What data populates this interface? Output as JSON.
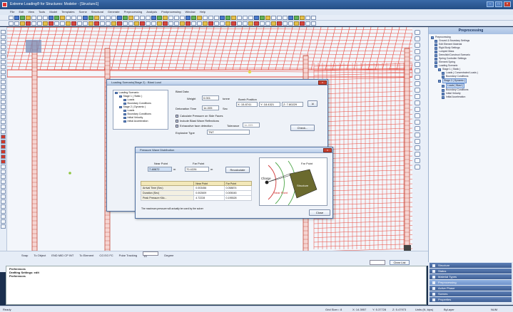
{
  "window": {
    "title": "Extreme Loading® for Structures: Modeler - [Structure1]",
    "min_label": "–",
    "max_label": "□",
    "close_label": "×"
  },
  "menu": [
    "File",
    "Edit",
    "View",
    "Tools",
    "Model",
    "Templates",
    "Scene",
    "Structural",
    "Generate",
    "Preprocessing",
    "Analysis",
    "Postprocessing",
    "Window",
    "Help"
  ],
  "right_panel": {
    "header": "Preprocessing",
    "tree": [
      {
        "label": "Preprocessing",
        "indent": 0
      },
      {
        "label": "Ground & Boundary Settings",
        "indent": 1
      },
      {
        "label": "Edit Element Material",
        "indent": 1
      },
      {
        "label": "Rigid Body Settings",
        "indent": 1
      },
      {
        "label": "Lumped Mass",
        "indent": 1
      },
      {
        "label": "Demolish/Construct Scenario",
        "indent": 1
      },
      {
        "label": "Spring Controller Settings",
        "indent": 1
      },
      {
        "label": "Element Spring",
        "indent": 1
      },
      {
        "label": "Loading Scenario",
        "indent": 1
      },
      {
        "label": "Stage 1 ( Static )",
        "indent": 2
      },
      {
        "label": "Loads ( Concentrated Loads )",
        "indent": 3
      },
      {
        "label": "Boundary Conditions",
        "indent": 3
      },
      {
        "label": "Stage 2 ( Dynamic )",
        "indent": 2,
        "selected": true
      },
      {
        "label": "Loads ( Blast )",
        "indent": 3,
        "selected": true
      },
      {
        "label": "Boundary Conditions",
        "indent": 3
      },
      {
        "label": "Initial Velocity",
        "indent": 3
      },
      {
        "label": "Initial Acceleration",
        "indent": 3
      }
    ],
    "tabs": [
      {
        "label": "Structure",
        "active": false
      },
      {
        "label": "Status",
        "active": false
      },
      {
        "label": "Material Types",
        "active": false
      },
      {
        "label": "Preprocessing",
        "active": true
      },
      {
        "label": "Active Phase",
        "active": false
      },
      {
        "label": "Scenes",
        "active": false
      },
      {
        "label": "Properties",
        "active": false
      }
    ]
  },
  "snap_bar": {
    "snap": "Snap",
    "to_object": "To Object",
    "object_opts": "END MID CP INT",
    "to_element": "To Element",
    "element_opts": "CG EG FC",
    "polar": "Polar Tracking",
    "polar_value": "15",
    "degree": "Degree"
  },
  "command": {
    "clear_label": "Clear List",
    "lines": [
      "Preferences",
      "Drafting Settings: edit",
      "Preferences"
    ]
  },
  "status": {
    "left": "Ready",
    "grid": "Grid Size=: 8",
    "x": "X: 14.3957",
    "y": "Y: 5.37728",
    "z": "Z: 5.47973",
    "units": "Units (N, kips)",
    "layer": "ByLayer",
    "mode": "NUM"
  },
  "loading_dialog": {
    "title": "Loading Scenario(Stage 2) : Blast Load",
    "close_label": "×",
    "tree": [
      {
        "label": "Loading Scenario",
        "indent": 0
      },
      {
        "label": "Stage 1 ( Static )",
        "indent": 1
      },
      {
        "label": "Loads",
        "indent": 2
      },
      {
        "label": "Boundary Conditions",
        "indent": 2
      },
      {
        "label": "Stage 2 ( Dynamic )",
        "indent": 1
      },
      {
        "label": "Loads",
        "indent": 2
      },
      {
        "label": "Boundary Conditions",
        "indent": 2
      },
      {
        "label": "Initial Velocity",
        "indent": 2
      },
      {
        "label": "Initial Acceleration",
        "indent": 2
      }
    ],
    "blast_data_label": "Blast Data",
    "weight_label": "Weight",
    "weight_value": "0.001",
    "weight_unit": "tonne",
    "bomb_position_label": "Bomb Position",
    "bx": "X: 15.8741",
    "by": "Y: 18.4321",
    "bz": "Z: 7.80229",
    "detonation_label": "Detonation Time",
    "detonation_value": "1e-005",
    "detonation_unit": "Sec",
    "cb1": "Calculate Pressure on Side Faces",
    "cb2": "Include Blast Wave Reflections",
    "cb3": "Exhaustive face detection",
    "tolerance_label": "Tolerance",
    "tolerance_value": "1e-005",
    "explosive_label": "Explosive Type",
    "explosive_value": "TNT",
    "check_label": "Check..."
  },
  "pressure_dialog": {
    "title": "Pressure Wave Distribution",
    "close_label": "×",
    "near_label": "Near Point",
    "far_label": "Far Point",
    "near_value": "7.48672",
    "far_value": "70.4226",
    "m_unit": "m",
    "recalc_label": "Recalculate",
    "table_headers": [
      "",
      "Near Point",
      "Far Point"
    ],
    "table_rows": [
      [
        "Arrival Time (Sec)",
        "0.003456",
        "0.058874"
      ],
      [
        "Duration (Sec)",
        "0.002609",
        "0.005045"
      ],
      [
        "Peak Pressure Kilo...",
        "4.72228",
        "0.195528"
      ]
    ],
    "note": "The maximum pressure will actually be used by the solver",
    "close_btn": "Close",
    "diagram": {
      "charge": "Charge",
      "far": "Far Point",
      "near": "Near Point",
      "structure": "Structure"
    }
  },
  "colors": {
    "frame": "#e8463a",
    "column": "#c24a3a",
    "beam_cap": "#7a8fb9",
    "structure_box": "#6b6a2e",
    "wave_green": "#4ba646",
    "wave_red": "#d13a3a"
  }
}
